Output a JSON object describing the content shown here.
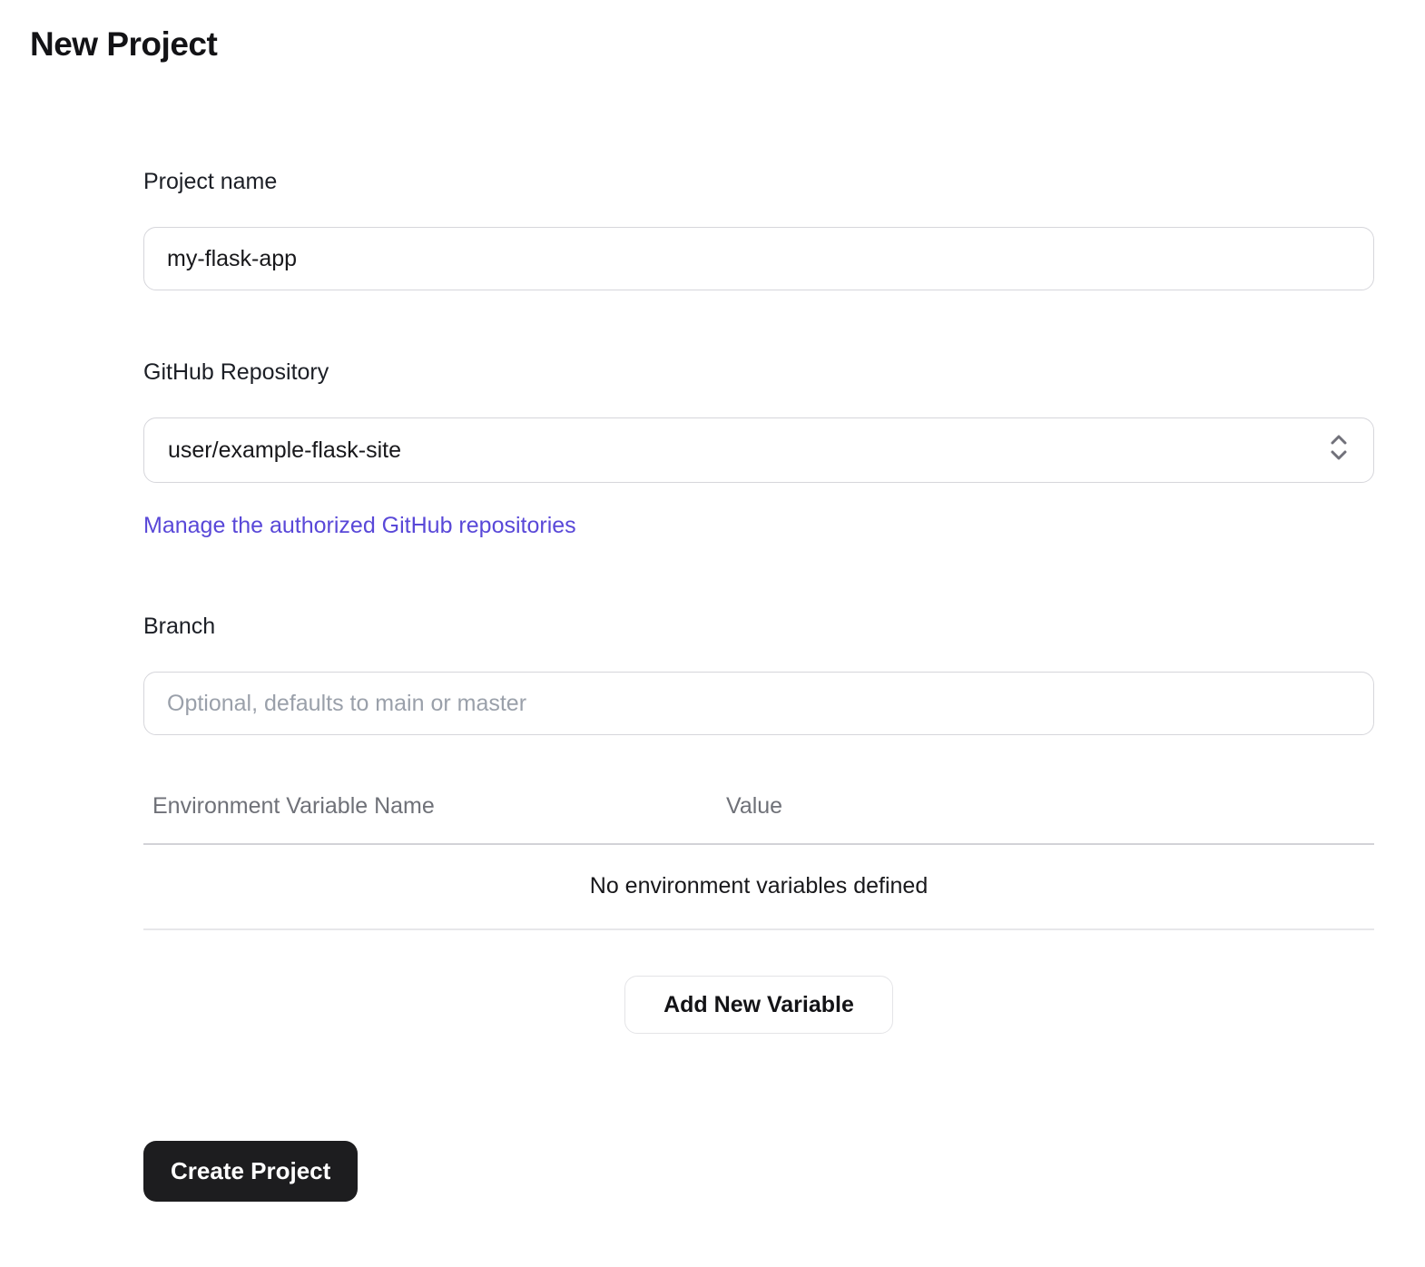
{
  "page": {
    "title": "New Project"
  },
  "form": {
    "project_name": {
      "label": "Project name",
      "value": "my-flask-app"
    },
    "repository": {
      "label": "GitHub Repository",
      "selected_option": "user/example-flask-site",
      "manage_link": "Manage the authorized GitHub repositories"
    },
    "branch": {
      "label": "Branch",
      "value": "",
      "placeholder": "Optional, defaults to main or master"
    },
    "env_vars": {
      "columns": {
        "name": "Environment Variable Name",
        "value": "Value"
      },
      "rows": [],
      "empty_message": "No environment variables defined",
      "add_button_label": "Add New Variable"
    },
    "submit_button_label": "Create Project"
  },
  "icons": {
    "repository_select": "chevron-up-down"
  },
  "colors": {
    "link": "#5948d8",
    "primary_button_bg": "#1d1d1f",
    "primary_button_text": "#ffffff",
    "input_border": "#d6d6db",
    "muted_text": "#6f7178",
    "placeholder_text": "#9aa0aa"
  }
}
